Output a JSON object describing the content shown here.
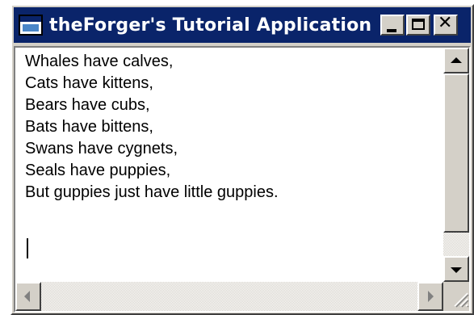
{
  "window": {
    "title": "theForger's Tutorial Application",
    "icon": "app-window-icon",
    "controls": {
      "minimize_icon": "minimize-icon",
      "maximize_icon": "maximize-icon",
      "close_icon": "close-icon",
      "close_glyph": "✕"
    }
  },
  "editor": {
    "lines": [
      "Whales have calves,",
      "Cats have kittens,",
      "Bears have cubs,",
      "Bats have bittens,",
      "Swans have cygnets,",
      "Seals have puppies,",
      "But guppies just have little guppies."
    ]
  },
  "scrollbars": {
    "vertical": {
      "up_icon": "arrow-up-icon",
      "down_icon": "arrow-down-icon",
      "enabled": true
    },
    "horizontal": {
      "left_icon": "arrow-left-icon",
      "right_icon": "arrow-right-icon",
      "enabled": false
    },
    "grip_icon": "resize-grip-icon"
  },
  "colors": {
    "titlebar": "#0a246a",
    "face": "#d4d0c8",
    "title_text": "#ffffff"
  }
}
